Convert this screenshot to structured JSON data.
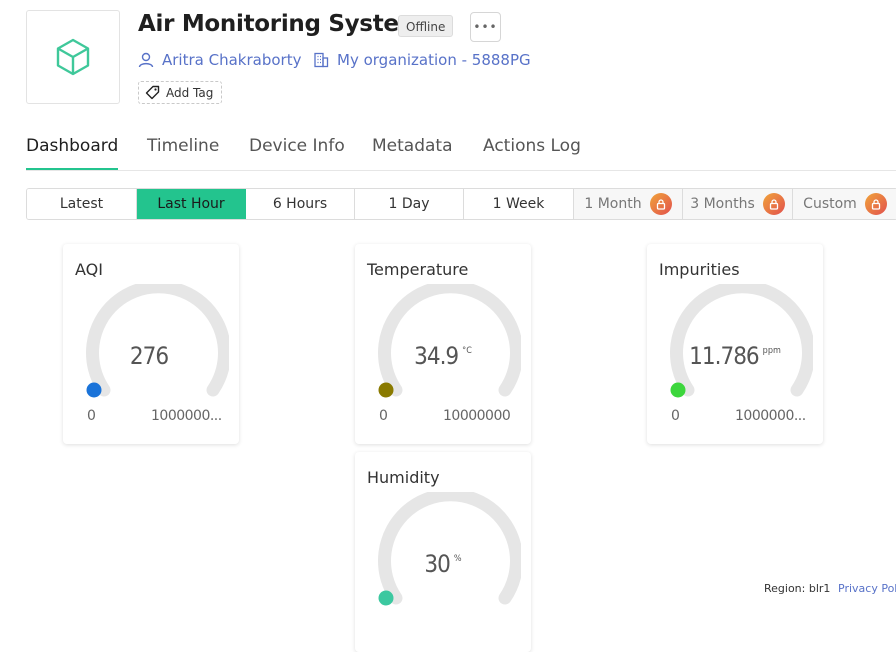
{
  "header": {
    "title": "Air Monitoring System",
    "status": "Offline",
    "more_label": "•••",
    "owner": "Aritra Chakraborty",
    "organization": "My organization - 5888PG",
    "add_tag_label": "Add Tag",
    "icons": {
      "device": "cube-icon",
      "owner": "user-icon",
      "organization": "building-icon",
      "tag": "tag-icon"
    }
  },
  "tabs": [
    {
      "label": "Dashboard",
      "active": true
    },
    {
      "label": "Timeline",
      "active": false
    },
    {
      "label": "Device Info",
      "active": false
    },
    {
      "label": "Metadata",
      "active": false
    },
    {
      "label": "Actions Log",
      "active": false
    }
  ],
  "time_ranges": [
    {
      "label": "Latest",
      "active": false,
      "locked": false
    },
    {
      "label": "Last Hour",
      "active": true,
      "locked": false
    },
    {
      "label": "6 Hours",
      "active": false,
      "locked": false
    },
    {
      "label": "1 Day",
      "active": false,
      "locked": false
    },
    {
      "label": "1 Week",
      "active": false,
      "locked": false
    },
    {
      "label": "1 Month",
      "active": false,
      "locked": true
    },
    {
      "label": "3 Months",
      "active": false,
      "locked": true
    },
    {
      "label": "Custom",
      "active": false,
      "locked": true
    }
  ],
  "widgets": [
    {
      "title": "AQI",
      "value": "276",
      "unit": "",
      "min": "0",
      "max": "1000000...",
      "color": "#1a73d9"
    },
    {
      "title": "Temperature",
      "value": "34.9",
      "unit": "°C",
      "min": "0",
      "max": "10000000",
      "color": "#8a7a00"
    },
    {
      "title": "Impurities",
      "value": "11.786",
      "unit": "ppm",
      "min": "0",
      "max": "1000000...",
      "color": "#3cd63c"
    },
    {
      "title": "Humidity",
      "value": "30",
      "unit": "%",
      "min": "",
      "max": "",
      "color": "#3cc8a0"
    }
  ],
  "footer": {
    "region": "Region: blr1",
    "privacy": "Privacy Pol"
  },
  "colors": {
    "accent": "#23c48e",
    "link": "#5872c8",
    "lock_gradient_start": "#f0a43a",
    "lock_gradient_end": "#e2504d"
  }
}
